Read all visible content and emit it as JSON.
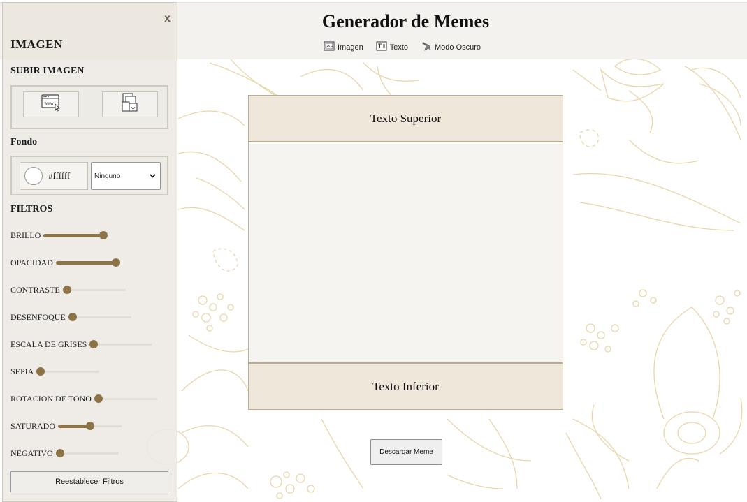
{
  "header": {
    "title": "Generador de Memes",
    "nav": [
      {
        "label": "Imagen",
        "icon": "image-icon"
      },
      {
        "label": "Texto",
        "icon": "text-icon"
      },
      {
        "label": "Modo Oscuro",
        "icon": "dark-mode-icon"
      }
    ]
  },
  "sidebar": {
    "close_label": "x",
    "title": "IMAGEN",
    "upload_heading": "SUBIR IMAGEN",
    "upload_buttons": [
      {
        "icon": "url-upload-icon"
      },
      {
        "icon": "file-upload-icon"
      }
    ],
    "background_heading": "Fondo",
    "background_color": "#ffffff",
    "background_color_text": "#ffffff",
    "blend_mode": "Ninguno",
    "filters_heading": "FILTROS",
    "filters": [
      {
        "label": "BRILLO",
        "value": 1.0
      },
      {
        "label": "OPACIDAD",
        "value": 1.0
      },
      {
        "label": "CONTRASTE",
        "value": 0.0
      },
      {
        "label": "DESENFOQUE",
        "value": 0.0
      },
      {
        "label": "ESCALA DE GRISES",
        "value": 0.0
      },
      {
        "label": "SEPIA",
        "value": 0.0
      },
      {
        "label": "ROTACION DE TONO",
        "value": 0.0
      },
      {
        "label": "SATURADO",
        "value": 0.5
      },
      {
        "label": "NEGATIVO",
        "value": 0.0
      }
    ],
    "reset_label": "Reestablecer Filtros"
  },
  "meme": {
    "top_text": "Texto Superior",
    "bottom_text": "Texto Inferior"
  },
  "download_label": "Descargar Meme",
  "colors": {
    "accent": "#8c7446",
    "panel": "#efe8da",
    "floral": "#e6d3a6"
  }
}
